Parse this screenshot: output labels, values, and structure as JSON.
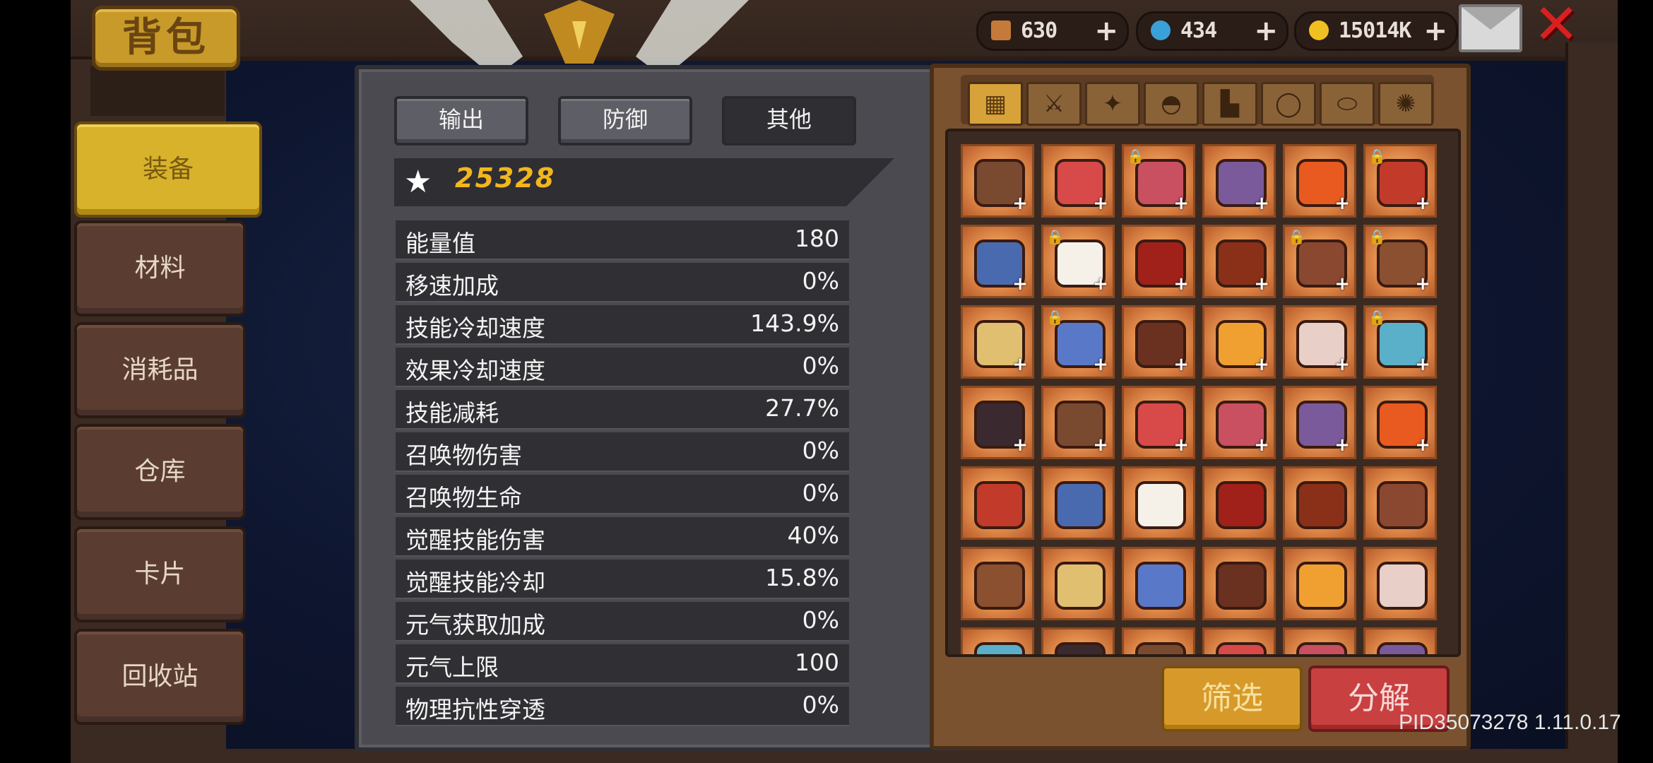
{
  "title": "背包",
  "currencies": [
    {
      "name": "material",
      "value": "630",
      "icon": "wood-icon",
      "color": "#c47a3a"
    },
    {
      "name": "gem",
      "value": "434",
      "icon": "gem-icon",
      "color": "#3aa0d8"
    },
    {
      "name": "gold",
      "value": "15014K",
      "icon": "coin-icon",
      "color": "#f0c020"
    }
  ],
  "sidebar": {
    "items": [
      {
        "label": "装备",
        "active": true
      },
      {
        "label": "材料"
      },
      {
        "label": "消耗品"
      },
      {
        "label": "仓库"
      },
      {
        "label": "卡片"
      },
      {
        "label": "回收站"
      }
    ]
  },
  "stats_panel": {
    "tabs": [
      "输出",
      "防御",
      "其他"
    ],
    "active_tab": "其他",
    "power": "25328",
    "rows": [
      {
        "k": "能量值",
        "v": "180"
      },
      {
        "k": "移速加成",
        "v": "0%"
      },
      {
        "k": "技能冷却速度",
        "v": "143.9%"
      },
      {
        "k": "效果冷却速度",
        "v": "0%"
      },
      {
        "k": "技能减耗",
        "v": "27.7%"
      },
      {
        "k": "召唤物伤害",
        "v": "0%"
      },
      {
        "k": "召唤物生命",
        "v": "0%"
      },
      {
        "k": "觉醒技能伤害",
        "v": "40%"
      },
      {
        "k": "觉醒技能冷却",
        "v": "15.8%"
      },
      {
        "k": "元气获取加成",
        "v": "0%"
      },
      {
        "k": "元气上限",
        "v": "100"
      },
      {
        "k": "物理抗性穿透",
        "v": "0%"
      }
    ]
  },
  "equipment": {
    "filter_tabs": [
      {
        "icon": "grid-icon",
        "glyph": "▦"
      },
      {
        "icon": "sword-icon",
        "glyph": "⚔"
      },
      {
        "icon": "pet-icon",
        "glyph": "✦"
      },
      {
        "icon": "helmet-icon",
        "glyph": "◓"
      },
      {
        "icon": "boots-icon",
        "glyph": "▙"
      },
      {
        "icon": "ring-icon",
        "glyph": "◯"
      },
      {
        "icon": "necklace-icon",
        "glyph": "⬭"
      },
      {
        "icon": "gear-icon",
        "glyph": "✺"
      }
    ],
    "items_color_palette": [
      "#c23a2a",
      "#e8d0c8",
      "#a0201a",
      "#7a4a30",
      "#8a5030",
      "#7a5a9a",
      "#6a3020",
      "#4a6ab0",
      "#5ab0c8",
      "#8a3018",
      "#d84a4a",
      "#e0c070",
      "#e85a20",
      "#f0a030",
      "#f5f0e8",
      "#3a2a30",
      "#8a4830",
      "#c85060",
      "#5a78c8"
    ],
    "filter_label": "筛选",
    "decompose_label": "分解"
  },
  "version": "PID35073278 1.11.0.17"
}
